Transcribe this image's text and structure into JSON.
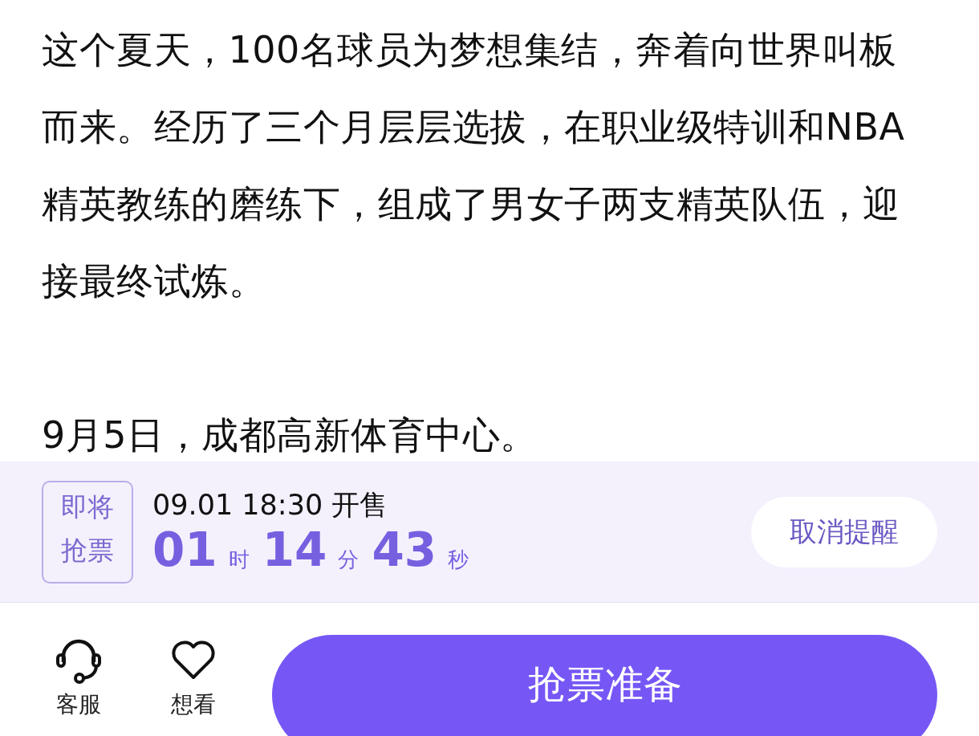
{
  "article": {
    "paragraphs": [
      "这个夏天，100名球员为梦想集结，奔着向世界叫板而来。经历了三个月层层选拔，在职业级特训和NBA精英教练的磨练下，组成了男女子两支精英队伍，迎接最终试炼。",
      "9月5日，成都高新体育中心。"
    ]
  },
  "sale_bar": {
    "badge": "即将抢票",
    "sale_time": "09.01 18:30 开售",
    "countdown": [
      {
        "value": "01",
        "unit": "时"
      },
      {
        "value": "14",
        "unit": "分"
      },
      {
        "value": "43",
        "unit": "秒"
      }
    ],
    "reminder_button": "取消提醒"
  },
  "bottom_bar": {
    "actions": [
      {
        "kind": "headset",
        "label": "客服"
      },
      {
        "kind": "heart",
        "label": "想看"
      }
    ],
    "primary_button": "抢票准备"
  }
}
